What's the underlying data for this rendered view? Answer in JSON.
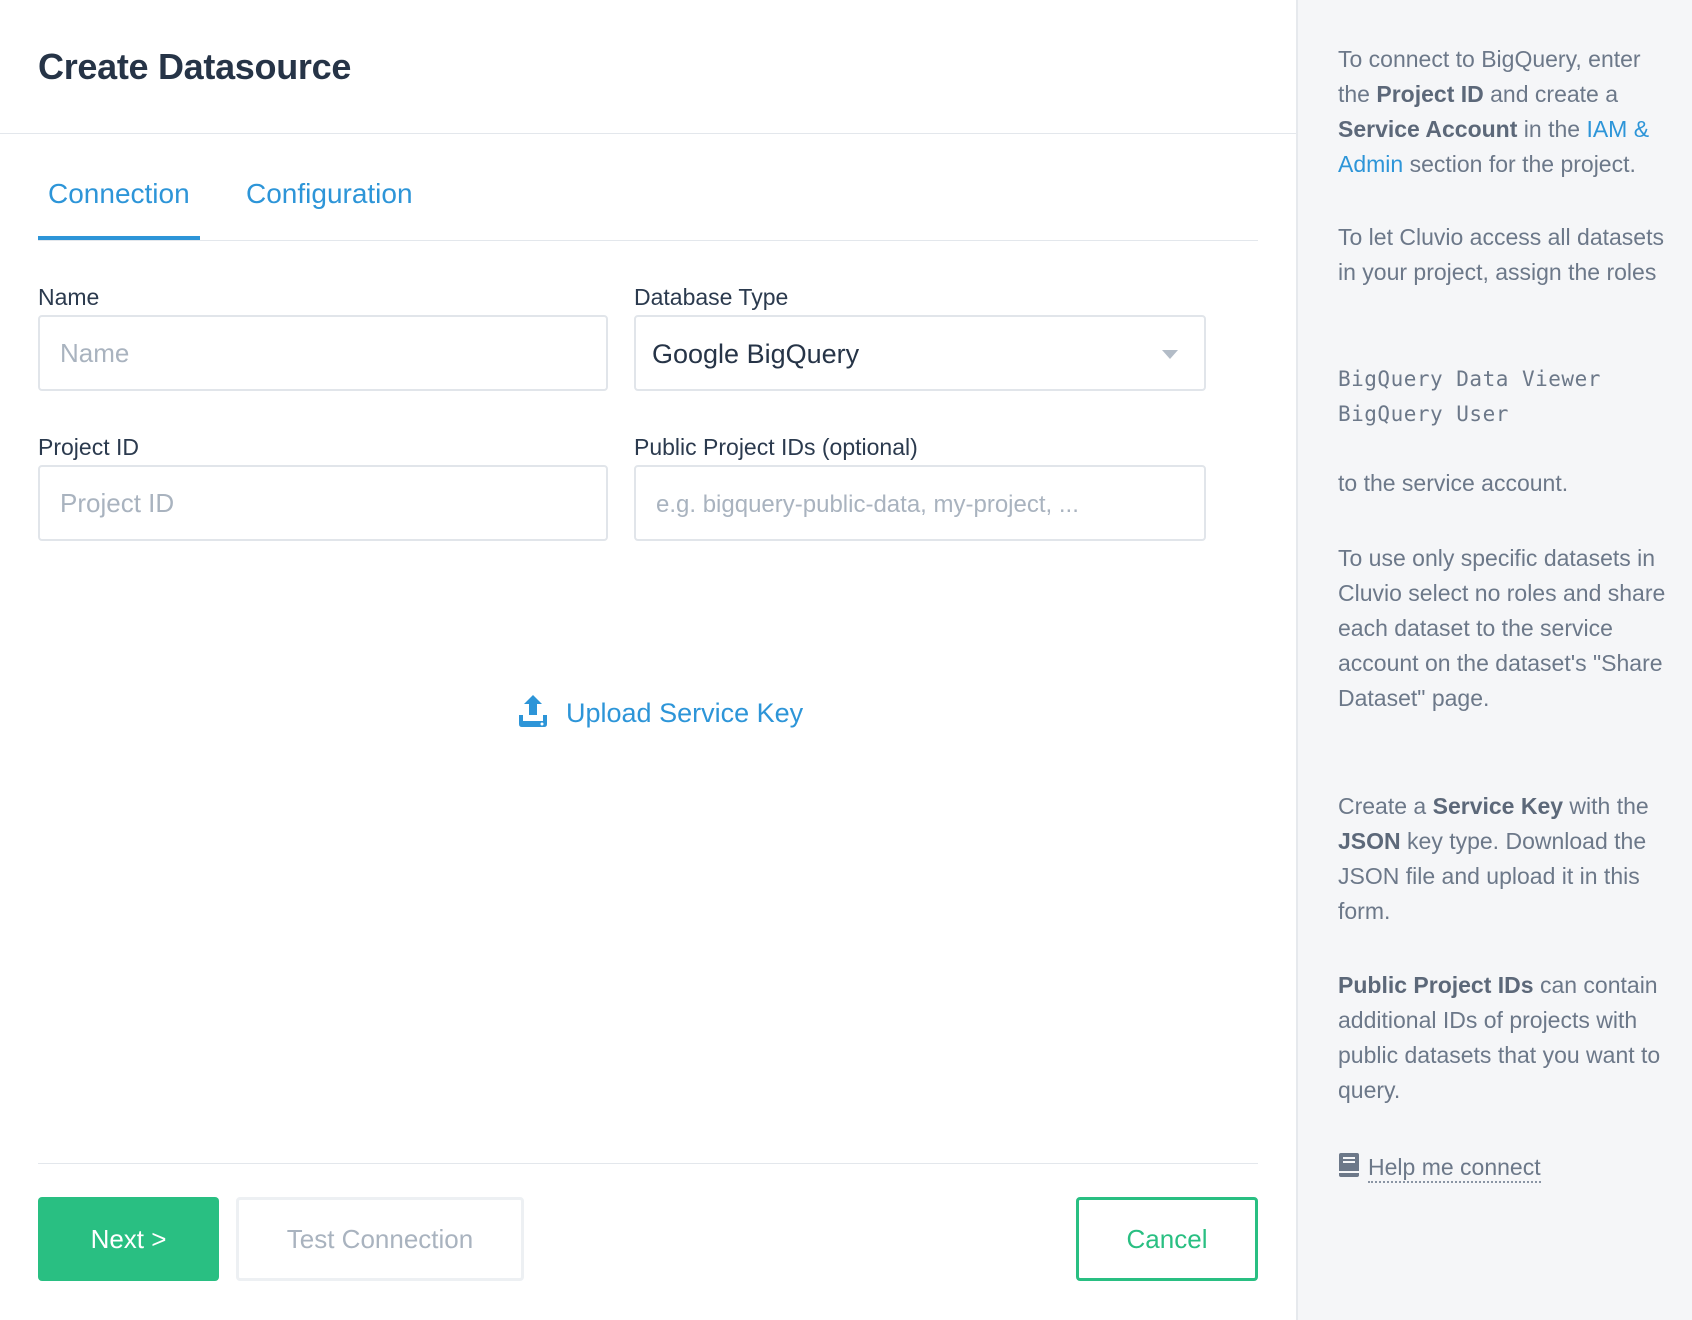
{
  "page": {
    "title": "Create Datasource"
  },
  "tabs": [
    {
      "label": "Connection",
      "active": true
    },
    {
      "label": "Configuration",
      "active": false
    }
  ],
  "form": {
    "name": {
      "label": "Name",
      "placeholder": "Name",
      "value": ""
    },
    "database_type": {
      "label": "Database Type",
      "value": "Google BigQuery"
    },
    "project_id": {
      "label": "Project ID",
      "placeholder": "Project ID",
      "value": ""
    },
    "public_project_ids": {
      "label": "Public Project IDs (optional)",
      "placeholder": "e.g. bigquery-public-data, my-project, ...",
      "value": ""
    },
    "upload": {
      "label": "Upload Service Key",
      "icon": "upload-icon"
    }
  },
  "buttons": {
    "next": "Next >",
    "test_connection": "Test Connection",
    "cancel": "Cancel"
  },
  "side": {
    "p1": {
      "t1": "To connect to BigQuery, enter the ",
      "b1": "Project ID",
      "t2": " and create a ",
      "b2": "Service Account",
      "t3": " in the ",
      "link": "IAM & Admin",
      "t4": " section for the project."
    },
    "p2": "To let Cluvio access all datasets in your project, assign the roles",
    "roles": [
      "BigQuery Data Viewer",
      "BigQuery User"
    ],
    "p3": "to the service account.",
    "p4": "To use only specific datasets in Cluvio select no roles and share each dataset to the service account on the dataset's \"Share Dataset\" page.",
    "p5": {
      "t1": "Create a ",
      "b1": "Service Key",
      "t2": " with the ",
      "b2": "JSON",
      "t3": " key type. Download the JSON file and upload it in this form."
    },
    "p6": {
      "b1": "Public Project IDs",
      "t1": " can contain additional IDs of projects with public datasets that you want to query."
    },
    "help": {
      "label": "Help me connect",
      "icon": "book-icon"
    }
  },
  "colors": {
    "accent_blue": "#2d95d8",
    "accent_green": "#29bf82",
    "title": "#263447",
    "side_bg": "#f5f6f8"
  }
}
